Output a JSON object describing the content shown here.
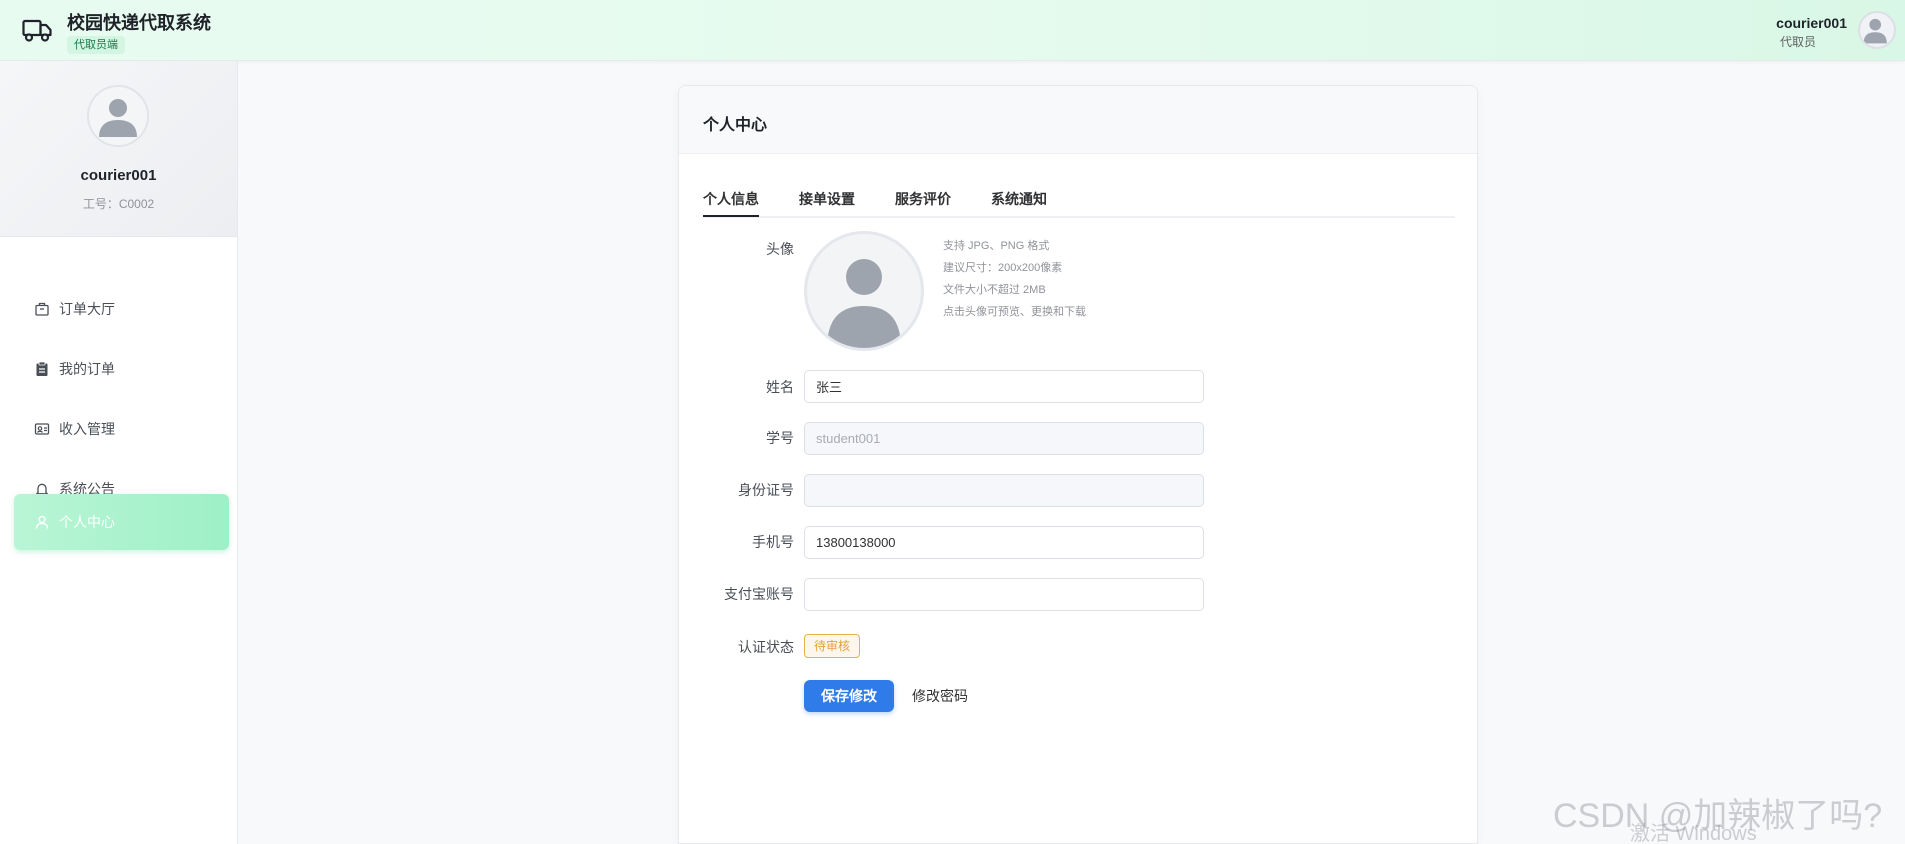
{
  "header": {
    "title": "校园快递代取系统",
    "role_tag": "代取员端",
    "username": "courier001",
    "user_role": "代取员"
  },
  "sidebar": {
    "name": "courier001",
    "employee_id": "工号：C0002",
    "items": [
      {
        "label": "订单大厅",
        "icon": "briefcase-icon"
      },
      {
        "label": "我的订单",
        "icon": "clipboard-icon"
      },
      {
        "label": "收入管理",
        "icon": "id-card-icon"
      },
      {
        "label": "系统公告",
        "icon": "bell-icon"
      },
      {
        "label": "个人中心",
        "icon": "user-icon",
        "active": true
      }
    ]
  },
  "main": {
    "title": "个人中心",
    "tabs": [
      "个人信息",
      "接单设置",
      "服务评价",
      "系统通知"
    ],
    "active_tab": 0,
    "avatar_label": "头像",
    "avatar_hints": [
      "支持 JPG、PNG 格式",
      "建议尺寸：200x200像素",
      "文件大小不超过 2MB",
      "点击头像可预览、更换和下载"
    ],
    "fields": {
      "name": {
        "label": "姓名",
        "value": "张三"
      },
      "student_id": {
        "label": "学号",
        "value": "student001"
      },
      "id_card": {
        "label": "身份证号",
        "value": ""
      },
      "phone": {
        "label": "手机号",
        "value": "13800138000"
      },
      "alipay": {
        "label": "支付宝账号",
        "value": ""
      }
    },
    "cert_status_label": "认证状态",
    "cert_status": "待审核",
    "save_label": "保存修改",
    "change_password_label": "修改密码"
  },
  "overlay": {
    "watermark": "CSDN @加辣椒了吗?",
    "activate": "激活 Windows"
  },
  "colors": {
    "primary": "#2f7bea",
    "accent_green": "#9ef0c6",
    "warning": "#e6a23c"
  }
}
